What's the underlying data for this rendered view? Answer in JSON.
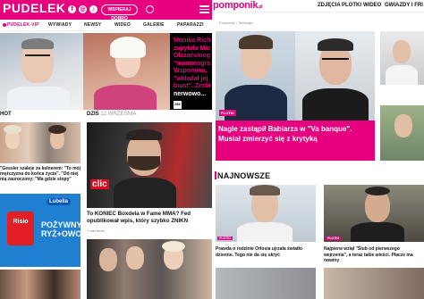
{
  "pudelek": {
    "logo": "PUDELEK",
    "social": [
      "f",
      "◎",
      "♪"
    ],
    "support_button": "WSPIERAJ DOBRO",
    "nav": [
      "PUDELEK-VIP",
      "WYWIADY",
      "NEWSY",
      "WIDEO",
      "GALERIE",
      "PAPARAZZI"
    ],
    "hero_quote_lines": [
      {
        "text": "Monika Rich",
        "white": false
      },
      {
        "text": "zapytała Mic",
        "white": false
      },
      {
        "text": "Olszańskieg",
        "white": false
      },
      {
        "text": "\"mammogra",
        "white": false
      },
      {
        "text": "Wspomina, ",
        "white": false
      },
      {
        "text": "\"wkładał jej",
        "white": false
      },
      {
        "text": "biust\". Zrobi",
        "white": false
      },
      {
        "text": "nerwowo...",
        "white": true
      }
    ],
    "hero_badge": "256",
    "section_left": "HOT",
    "section_today_label": "DZIŚ",
    "section_today_date": "12 WRZEŚNIA",
    "card_left_text": "\"Gessler szaleje za kelnerem: \"To mój mężczyzna do końca życia\". \"Od niej nią zauroczony: \"Ma gdzie stopy\"",
    "lubella": {
      "brand": "Lubella",
      "product": "Risio",
      "slogan_lines": [
        "POŻYWNY",
        "RYŻ+OWOCE"
      ]
    },
    "card_main_text": "To KONIEC Boxdela w Fame MMA? Fed opublikował wpis, który szybko ZNIKN",
    "card_main_meta": "7 min temu",
    "card_main_badge": "clic"
  },
  "pomponik": {
    "logo": "pomponik",
    "logo_suffix": ".pl",
    "nav": [
      "ZDJĘCIA",
      "PLOTKI",
      "WIDEO",
      "GWIAZDY I FRI"
    ],
    "breadcrumb": "Pomponik  ›  Telewizja",
    "hero_badge": "PLOTKI",
    "hero_headline": "Nagle zastąpił Babiarza w \"Va banque\". Musiał zmierzyć się z krytyką",
    "section": "NAJNOWSZE",
    "cards": [
      {
        "badge": "PLOTKI",
        "text": "Prawda o rodzinie Orłosia ujrzała światło dzienne. Tego nie da się ukryć"
      },
      {
        "badge": "PLOTKI",
        "text": "Najpierw wziął \"Ślub od pierwszego wejrzenia\", a teraz takie wieści. Płacze ma nowiny"
      }
    ]
  }
}
